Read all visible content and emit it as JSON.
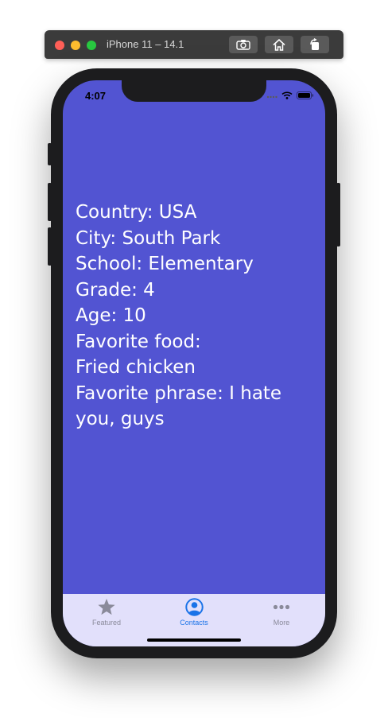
{
  "simulator": {
    "title": "iPhone 11 – 14.1"
  },
  "status_bar": {
    "time": "4:07"
  },
  "profile": {
    "lines": [
      "Country: USA",
      "City: South Park",
      "School: Elementary",
      "Grade: 4",
      "Age: 10",
      "Favorite food:",
      "Fried chicken",
      "Favorite phrase: I hate you, guys"
    ]
  },
  "tabbar": {
    "tabs": [
      {
        "label": "Featured",
        "icon": "star-icon",
        "active": false
      },
      {
        "label": "Contacts",
        "icon": "person-circle-icon",
        "active": true
      },
      {
        "label": "More",
        "icon": "more-icon",
        "active": false
      }
    ]
  },
  "colors": {
    "background": "#5254d2",
    "tabbar": "#e2e0fb",
    "active_tint": "#1a73e8",
    "inactive_tint": "#8a8a9a"
  }
}
